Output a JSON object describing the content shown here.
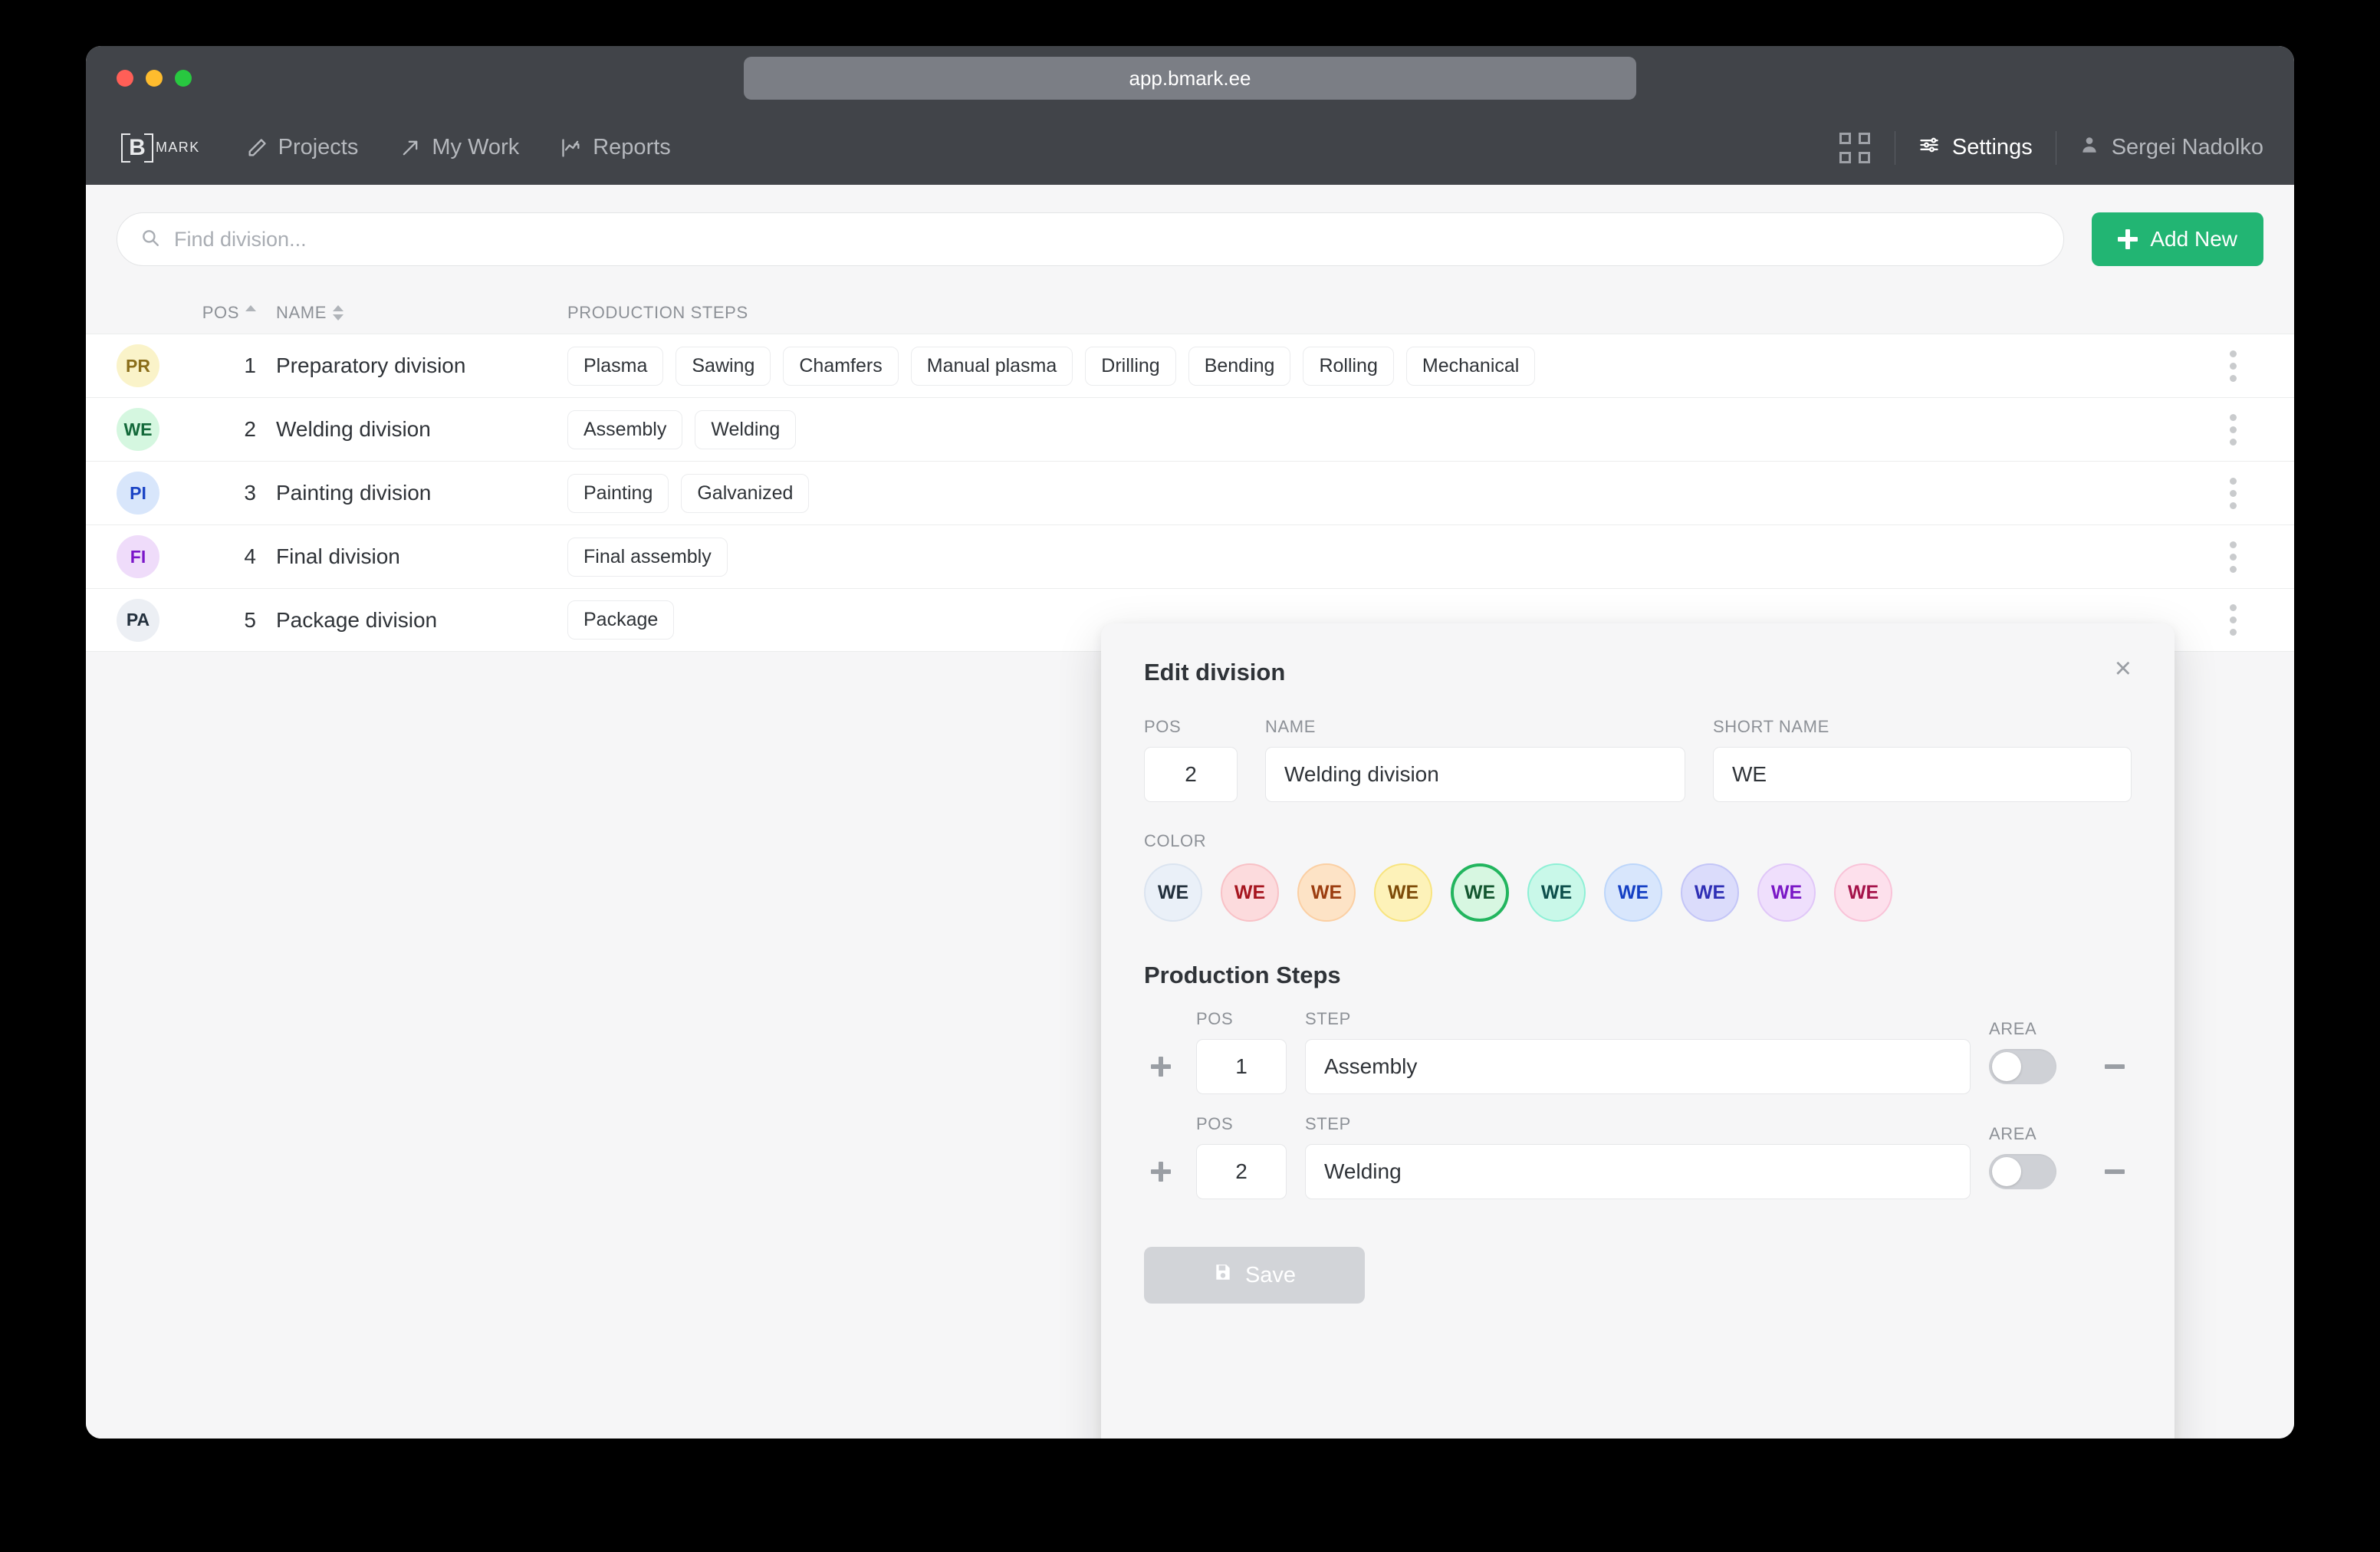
{
  "browser": {
    "url": "app.bmark.ee"
  },
  "nav": {
    "logo_letter": "B",
    "logo_text": "MARK",
    "links": [
      {
        "label": "Projects",
        "icon": "pencil-icon"
      },
      {
        "label": "My Work",
        "icon": "arrow-icon"
      },
      {
        "label": "Reports",
        "icon": "chart-icon"
      }
    ],
    "settings_label": "Settings",
    "user_name": "Sergei Nadolko"
  },
  "toolbar": {
    "search_placeholder": "Find division...",
    "search_value": "",
    "add_new_label": "Add New"
  },
  "table": {
    "headers": {
      "pos": "POS",
      "name": "NAME",
      "steps": "PRODUCTION STEPS"
    },
    "rows": [
      {
        "short": "PR",
        "pos": "1",
        "name": "Preparatory division",
        "avatar_bg": "#faf3c9",
        "avatar_fg": "#8a6d1a",
        "steps": [
          "Plasma",
          "Sawing",
          "Chamfers",
          "Manual plasma",
          "Drilling",
          "Bending",
          "Rolling",
          "Mechanical"
        ]
      },
      {
        "short": "WE",
        "pos": "2",
        "name": "Welding division",
        "avatar_bg": "#d5f7e0",
        "avatar_fg": "#13693a",
        "steps": [
          "Assembly",
          "Welding"
        ]
      },
      {
        "short": "PI",
        "pos": "3",
        "name": "Painting division",
        "avatar_bg": "#d8e6fb",
        "avatar_fg": "#1a43c4",
        "steps": [
          "Painting",
          "Galvanized"
        ]
      },
      {
        "short": "FI",
        "pos": "4",
        "name": "Final division",
        "avatar_bg": "#efdcfa",
        "avatar_fg": "#7b16c9",
        "steps": [
          "Final assembly"
        ]
      },
      {
        "short": "PA",
        "pos": "5",
        "name": "Package division",
        "avatar_bg": "#eceff4",
        "avatar_fg": "#23303d",
        "steps": [
          "Package"
        ]
      }
    ]
  },
  "modal": {
    "title": "Edit division",
    "close_label": "×",
    "labels": {
      "pos": "POS",
      "name": "NAME",
      "short_name": "SHORT NAME",
      "color": "COLOR"
    },
    "pos_value": "2",
    "name_value": "Welding division",
    "short_name_value": "WE",
    "swatch_label": "WE",
    "colors": [
      {
        "name": "slate",
        "bg": "#eaf0f8",
        "fg": "#23303d",
        "ring": "#dbe4f0",
        "selected": false
      },
      {
        "name": "red",
        "bg": "#fcdbdd",
        "fg": "#a6151f",
        "ring": "#f8c1c6",
        "selected": false
      },
      {
        "name": "orange",
        "bg": "#fde3c6",
        "fg": "#9c3d10",
        "ring": "#fbcfa3",
        "selected": false
      },
      {
        "name": "yellow",
        "bg": "#fdf2b9",
        "fg": "#7e4c09",
        "ring": "#f8e47f",
        "selected": false
      },
      {
        "name": "green",
        "bg": "#d7f7e1",
        "fg": "#13562f",
        "ring": "#22b55e",
        "selected": true
      },
      {
        "name": "teal",
        "bg": "#c9f8e9",
        "fg": "#0d4f4c",
        "ring": "#8ef0d6",
        "selected": false
      },
      {
        "name": "blue",
        "bg": "#d8e6fc",
        "fg": "#1540c4",
        "ring": "#bdd6fa",
        "selected": false
      },
      {
        "name": "indigo",
        "bg": "#dbdcfb",
        "fg": "#2f2fb5",
        "ring": "#c3c5f7",
        "selected": false
      },
      {
        "name": "purple",
        "bg": "#efdffc",
        "fg": "#7a18c6",
        "ring": "#e0c7f8",
        "selected": false
      },
      {
        "name": "pink",
        "bg": "#fde0ec",
        "fg": "#a5134a",
        "ring": "#f9c3d8",
        "selected": false
      }
    ],
    "production_steps_title": "Production Steps",
    "step_labels": {
      "pos": "POS",
      "step": "STEP",
      "area": "AREA"
    },
    "steps": [
      {
        "pos": "1",
        "step": "Assembly",
        "area_on": false
      },
      {
        "pos": "2",
        "step": "Welding",
        "area_on": false
      }
    ],
    "save_label": "Save"
  }
}
